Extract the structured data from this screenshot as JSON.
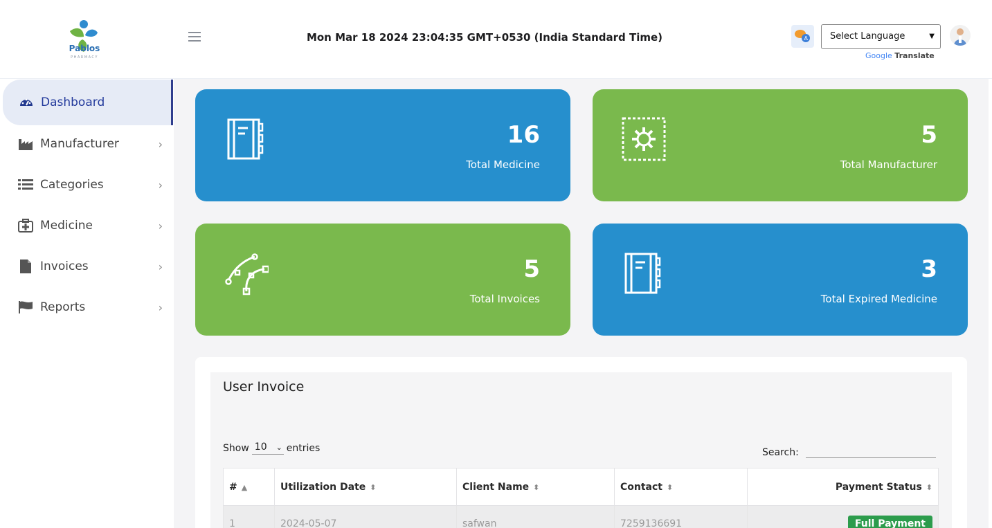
{
  "brand": {
    "name": "Pablos",
    "tagline": "PHARMACY"
  },
  "header": {
    "datetime": "Mon Mar 18 2024 23:04:35 GMT+0530 (India Standard Time)",
    "language_select": "Select Language",
    "translate_google": "Google",
    "translate_label": "Translate"
  },
  "sidebar": {
    "items": [
      {
        "label": "Dashboard",
        "icon": "dashboard-icon",
        "active": true
      },
      {
        "label": "Manufacturer",
        "icon": "factory-icon"
      },
      {
        "label": "Categories",
        "icon": "list-icon"
      },
      {
        "label": "Medicine",
        "icon": "medical-kit-icon"
      },
      {
        "label": "Invoices",
        "icon": "file-icon"
      },
      {
        "label": "Reports",
        "icon": "flag-icon"
      }
    ]
  },
  "cards": [
    {
      "value": "16",
      "label": "Total Medicine",
      "color": "#268fcd",
      "icon": "notebook-icon"
    },
    {
      "value": "5",
      "label": "Total Manufacturer",
      "color": "#7ab94d",
      "icon": "gear-icon"
    },
    {
      "value": "5",
      "label": "Total Invoices",
      "color": "#7ab94d",
      "icon": "vector-path-icon"
    },
    {
      "value": "3",
      "label": "Total Expired Medicine",
      "color": "#268fcd",
      "icon": "notebook-icon"
    }
  ],
  "invoice": {
    "title": "User Invoice",
    "show_label": "Show",
    "show_value": "10",
    "entries_label": "entries",
    "search_label": "Search:",
    "columns": [
      "#",
      "Utilization Date",
      "Client Name",
      "Contact",
      "Payment Status"
    ],
    "rows": [
      {
        "num": "1",
        "date": "2024-05-07",
        "client": "safwan",
        "contact": "7259136691",
        "status": "Full Payment"
      }
    ]
  }
}
